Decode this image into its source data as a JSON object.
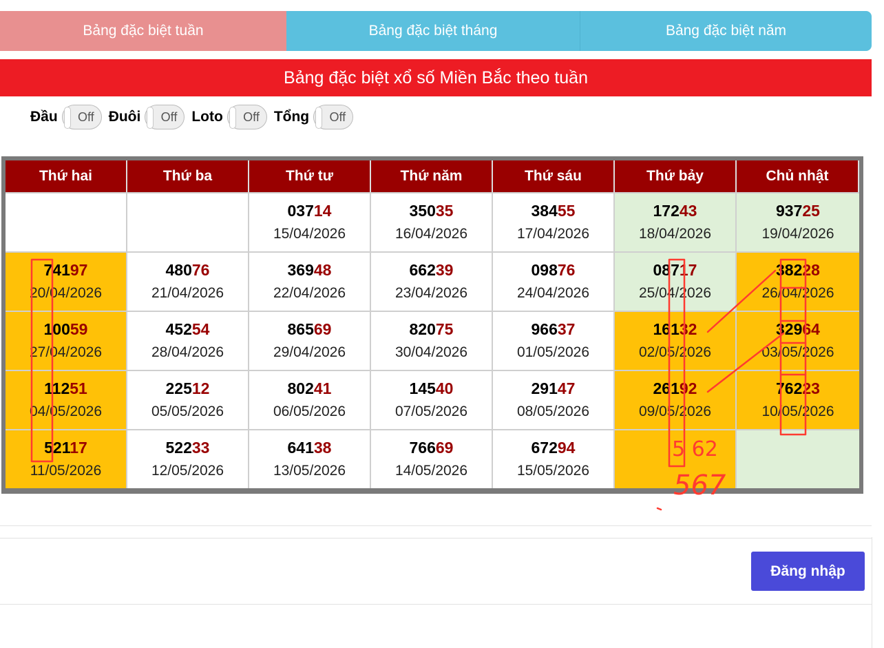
{
  "tabs": [
    {
      "label": "Bảng đặc biệt tuần",
      "active": true
    },
    {
      "label": "Bảng đặc biệt tháng",
      "active": false
    },
    {
      "label": "Bảng đặc biệt năm",
      "active": false
    }
  ],
  "banner": "Bảng đặc biệt xổ số Miền Bắc theo tuần",
  "toggles": [
    {
      "label": "Đầu",
      "state": "Off"
    },
    {
      "label": "Đuôi",
      "state": "Off"
    },
    {
      "label": "Loto",
      "state": "Off"
    },
    {
      "label": "Tổng",
      "state": "Off"
    }
  ],
  "table": {
    "headers": [
      "Thứ hai",
      "Thứ ba",
      "Thứ tư",
      "Thứ năm",
      "Thứ sáu",
      "Thứ bảy",
      "Chủ nhật"
    ],
    "rows": [
      [
        {
          "head": "",
          "tail": "",
          "date": "",
          "bg": "white"
        },
        {
          "head": "",
          "tail": "",
          "date": "",
          "bg": "white"
        },
        {
          "head": "037",
          "tail": "14",
          "date": "15/04/2026",
          "bg": "white"
        },
        {
          "head": "350",
          "tail": "35",
          "date": "16/04/2026",
          "bg": "white"
        },
        {
          "head": "384",
          "tail": "55",
          "date": "17/04/2026",
          "bg": "white"
        },
        {
          "head": "172",
          "tail": "43",
          "date": "18/04/2026",
          "bg": "green"
        },
        {
          "head": "937",
          "tail": "25",
          "date": "19/04/2026",
          "bg": "green"
        }
      ],
      [
        {
          "head": "741",
          "tail": "97",
          "date": "20/04/2026",
          "bg": "yellow"
        },
        {
          "head": "480",
          "tail": "76",
          "date": "21/04/2026",
          "bg": "white"
        },
        {
          "head": "369",
          "tail": "48",
          "date": "22/04/2026",
          "bg": "white"
        },
        {
          "head": "662",
          "tail": "39",
          "date": "23/04/2026",
          "bg": "white"
        },
        {
          "head": "098",
          "tail": "76",
          "date": "24/04/2026",
          "bg": "white"
        },
        {
          "head": "087",
          "tail": "17",
          "date": "25/04/2026",
          "bg": "green"
        },
        {
          "head": "382",
          "tail": "28",
          "date": "26/04/2026",
          "bg": "yellow"
        }
      ],
      [
        {
          "head": "100",
          "tail": "59",
          "date": "27/04/2026",
          "bg": "yellow"
        },
        {
          "head": "452",
          "tail": "54",
          "date": "28/04/2026",
          "bg": "white"
        },
        {
          "head": "865",
          "tail": "69",
          "date": "29/04/2026",
          "bg": "white"
        },
        {
          "head": "820",
          "tail": "75",
          "date": "30/04/2026",
          "bg": "white"
        },
        {
          "head": "966",
          "tail": "37",
          "date": "01/05/2026",
          "bg": "white"
        },
        {
          "head": "161",
          "tail": "32",
          "date": "02/05/2026",
          "bg": "yellow"
        },
        {
          "head": "329",
          "tail": "64",
          "date": "03/05/2026",
          "bg": "yellow"
        }
      ],
      [
        {
          "head": "112",
          "tail": "51",
          "date": "04/05/2026",
          "bg": "yellow"
        },
        {
          "head": "225",
          "tail": "12",
          "date": "05/05/2026",
          "bg": "white"
        },
        {
          "head": "802",
          "tail": "41",
          "date": "06/05/2026",
          "bg": "white"
        },
        {
          "head": "145",
          "tail": "40",
          "date": "07/05/2026",
          "bg": "white"
        },
        {
          "head": "291",
          "tail": "47",
          "date": "08/05/2026",
          "bg": "white"
        },
        {
          "head": "261",
          "tail": "92",
          "date": "09/05/2026",
          "bg": "yellow"
        },
        {
          "head": "762",
          "tail": "23",
          "date": "10/05/2026",
          "bg": "yellow"
        }
      ],
      [
        {
          "head": "521",
          "tail": "17",
          "date": "11/05/2026",
          "bg": "yellow"
        },
        {
          "head": "522",
          "tail": "33",
          "date": "12/05/2026",
          "bg": "white"
        },
        {
          "head": "641",
          "tail": "38",
          "date": "13/05/2026",
          "bg": "white"
        },
        {
          "head": "766",
          "tail": "69",
          "date": "14/05/2026",
          "bg": "white"
        },
        {
          "head": "672",
          "tail": "94",
          "date": "15/05/2026",
          "bg": "white"
        },
        {
          "head": "",
          "tail": "",
          "date": "",
          "bg": "yellow"
        },
        {
          "head": "",
          "tail": "",
          "date": "",
          "bg": "green"
        }
      ]
    ]
  },
  "annotations": {
    "handwriting_1": "5  62",
    "handwriting_2": "567",
    "color": "#ff3b30"
  },
  "login": {
    "label": "Đăng nhập"
  },
  "colors": {
    "tab_active": "#e89090",
    "tab_inactive": "#5bc0de",
    "banner": "#ed1c24",
    "header_row": "#990000",
    "tail_digits": "#990000",
    "green_cell": "#dff0d8",
    "yellow_cell": "#ffc107",
    "login_button": "#4a4ad9"
  }
}
